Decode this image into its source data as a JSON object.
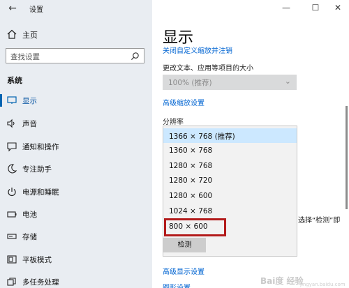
{
  "window": {
    "title": "设置",
    "back_glyph": "←",
    "minimize_glyph": "—",
    "maximize_glyph": "☐",
    "close_glyph": "✕"
  },
  "sidebar": {
    "home_label": "主页",
    "search_placeholder": "查找设置",
    "section_label": "系统",
    "items": [
      {
        "label": "显示",
        "icon": "monitor-icon",
        "active": true
      },
      {
        "label": "声音",
        "icon": "speaker-icon"
      },
      {
        "label": "通知和操作",
        "icon": "notification-icon"
      },
      {
        "label": "专注助手",
        "icon": "moon-icon"
      },
      {
        "label": "电源和睡眠",
        "icon": "power-icon"
      },
      {
        "label": "电池",
        "icon": "battery-icon"
      },
      {
        "label": "存储",
        "icon": "storage-icon"
      },
      {
        "label": "平板模式",
        "icon": "tablet-icon"
      },
      {
        "label": "多任务处理",
        "icon": "multitask-icon"
      }
    ]
  },
  "main": {
    "title": "显示",
    "close_scaling_link": "关闭自定义缩放并注销",
    "scale_section_label": "更改文本、应用等项目的大小",
    "scale_value": "100% (推荐)",
    "advanced_scaling_link": "高级缩放设置",
    "resolution_label": "分辨率",
    "resolution_options": [
      "1366 × 768 (推荐)",
      "1360 × 768",
      "1280 × 768",
      "1280 × 720",
      "1280 × 600",
      "1024 × 768",
      "800 × 600"
    ],
    "selected_option": "1366 × 768 (推荐)",
    "highlighted_option": "800 × 600",
    "partial_text": "选择“检测”即",
    "detect_button": "检测",
    "advanced_display_link": "高级显示设置",
    "bottom_link_partial": "图形设置"
  },
  "watermark": {
    "text": "Bai度 经验",
    "sub": "jingyan.baidu.com"
  },
  "colors": {
    "accent": "#0063b1",
    "link": "#0064d2",
    "sidebar_bg": "#e9edf2",
    "highlight_border": "#b31b1b",
    "selected_bg": "#cce8ff"
  }
}
